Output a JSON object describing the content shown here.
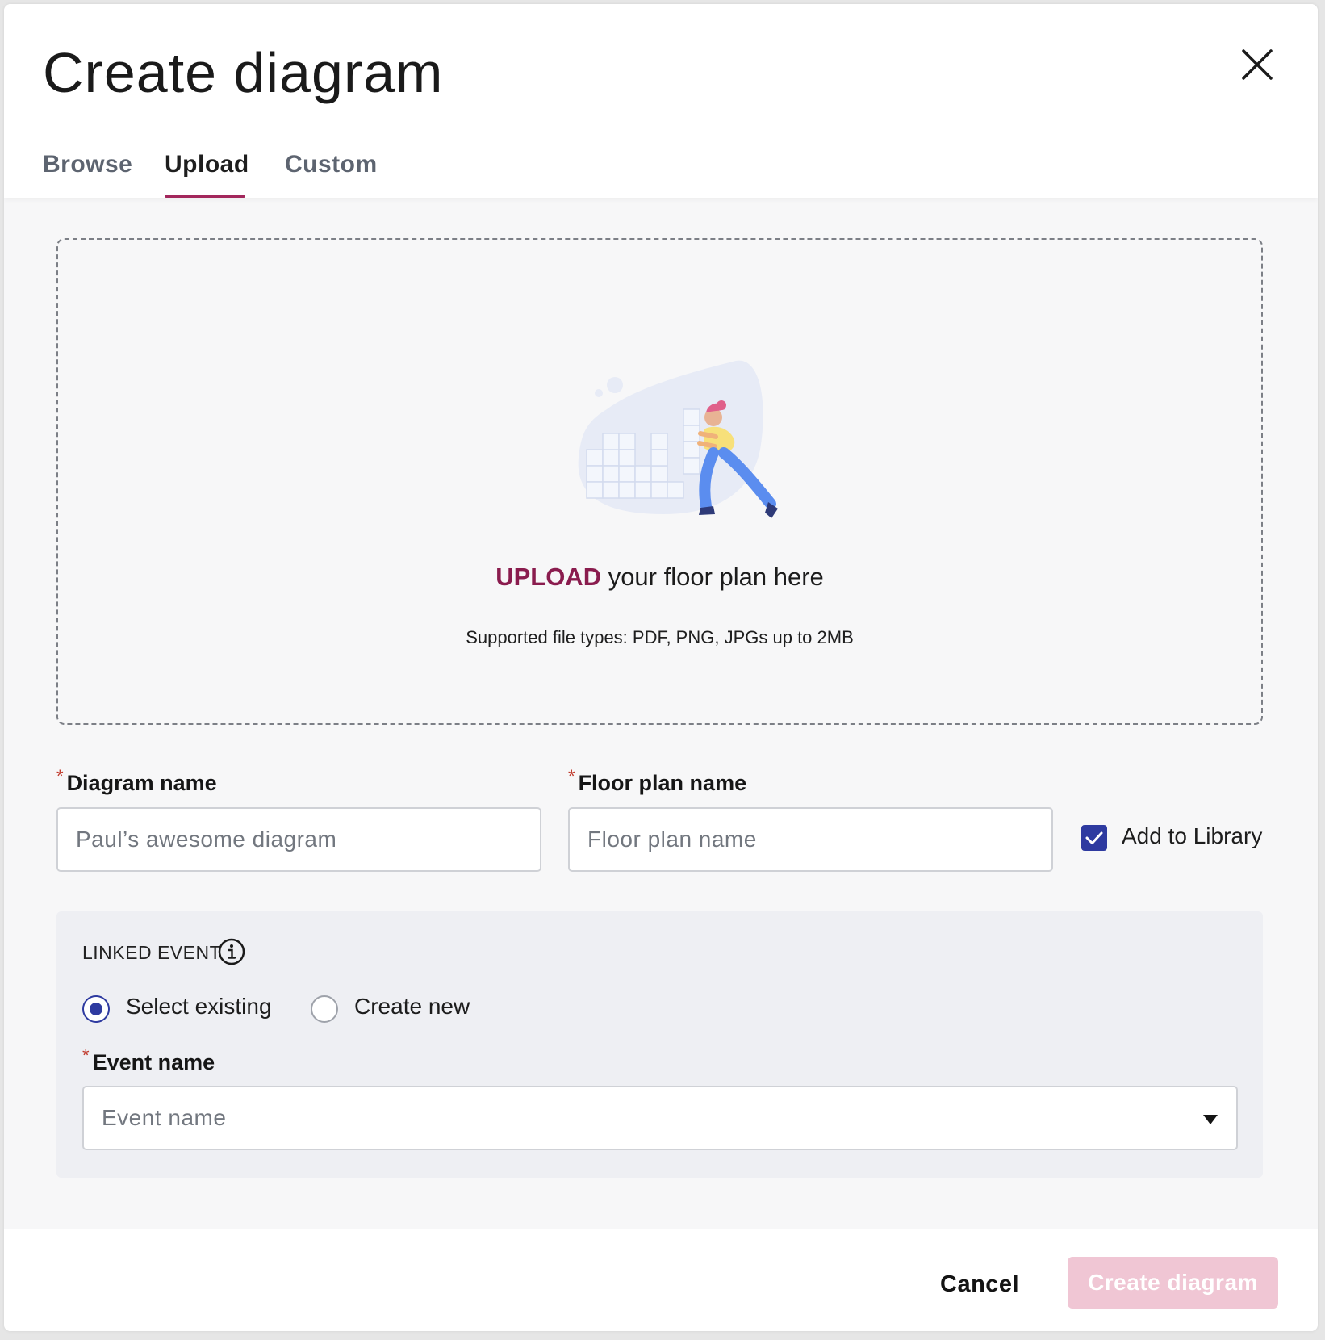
{
  "dialog": {
    "title": "Create diagram",
    "close_icon": "close-icon"
  },
  "tabs": [
    {
      "label": "Browse",
      "active": false
    },
    {
      "label": "Upload",
      "active": true
    },
    {
      "label": "Custom",
      "active": false
    }
  ],
  "upload": {
    "action_word": "UPLOAD",
    "prompt": " your floor plan here",
    "supported": "Supported file types: PDF, PNG, JPGs up to 2MB",
    "illustration": "person-pushing-floorplan-illustration"
  },
  "fields": {
    "diagram_name": {
      "label": "Diagram name",
      "required_mark": "*",
      "value": "Paul’s awesome diagram"
    },
    "floor_plan_name": {
      "label": "Floor plan name",
      "required_mark": "*",
      "placeholder": "Floor plan name"
    },
    "add_to_library": {
      "label": "Add to Library",
      "checked": true
    }
  },
  "linked_event": {
    "title": "LINKED EVENT",
    "info_icon": "info-icon",
    "options": [
      {
        "label": "Select existing",
        "selected": true
      },
      {
        "label": "Create new",
        "selected": false
      }
    ],
    "event_name": {
      "label": "Event name",
      "required_mark": "*",
      "placeholder": "Event name"
    }
  },
  "footer": {
    "cancel_label": "Cancel",
    "create_label": "Create diagram"
  },
  "colors": {
    "accent": "#a3275c",
    "upload_word": "#8a1c4e",
    "primary": "#2e3aa0",
    "create_disabled_bg": "#f0c6d4"
  }
}
